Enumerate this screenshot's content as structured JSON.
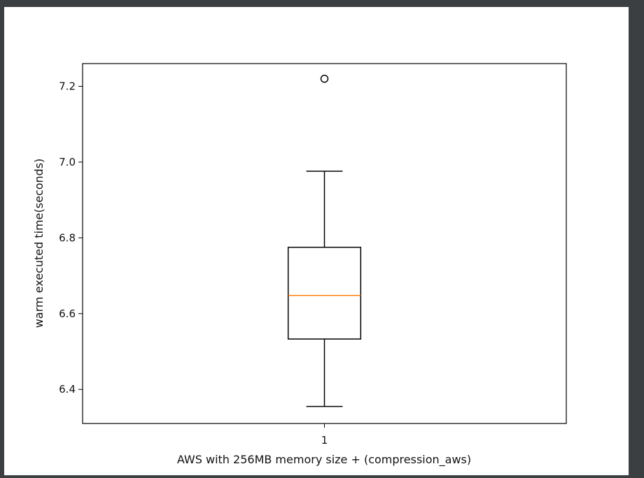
{
  "chart_data": {
    "type": "boxplot",
    "title": "",
    "xlabel": "AWS with 256MB memory size + (compression_aws)",
    "ylabel": "warm executed time(seconds)",
    "ylim": [
      6.31,
      7.26
    ],
    "xlim": [
      0.5,
      1.5
    ],
    "yticks": [
      6.4,
      6.6,
      6.8,
      7.0,
      7.2
    ],
    "ytick_labels": [
      "6.4",
      "6.6",
      "6.8",
      "7.0",
      "7.2"
    ],
    "categories": [
      "1"
    ],
    "boxes": [
      {
        "position": 1,
        "whisker_low": 6.355,
        "q1": 6.533,
        "median": 6.648,
        "q3": 6.775,
        "whisker_high": 6.976,
        "outliers": [
          7.22
        ]
      }
    ],
    "grid": false,
    "colors": {
      "box": "#000000",
      "median": "#ff7f0e",
      "outlier": "#000000"
    }
  }
}
